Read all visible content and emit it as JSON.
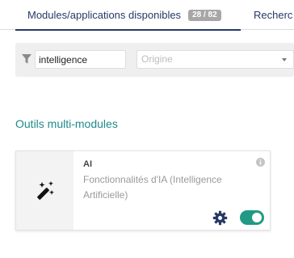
{
  "tabs": {
    "active_label": "Modules/applications disponibles",
    "active_count": "28 / 82",
    "second_label": "Recherc"
  },
  "filters": {
    "search_value": "intelligence",
    "origin_placeholder": "Origine"
  },
  "section": {
    "title": "Outils multi-modules"
  },
  "module_card": {
    "name": "AI",
    "description": "Fonctionnalités d'IA (Intelligence Artificielle)",
    "icon": "magic-wand-icon",
    "enabled": true
  },
  "colors": {
    "tab_text": "#263a67",
    "section_title": "#1f8a8c",
    "toggle_on": "#1f9a85",
    "gear": "#263a67",
    "badge_bg": "#a7a7a7"
  }
}
